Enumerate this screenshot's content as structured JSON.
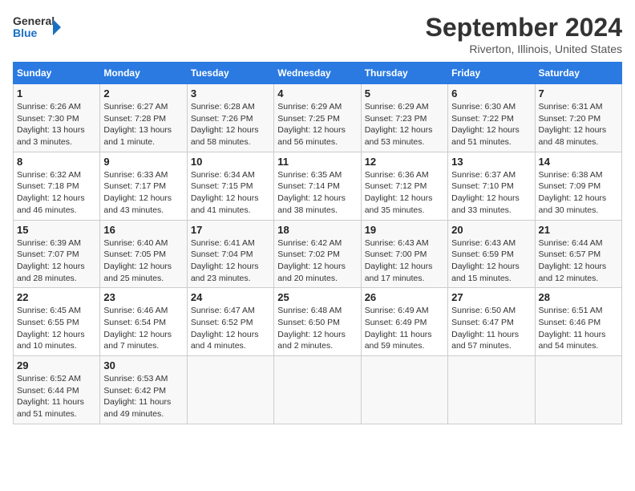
{
  "header": {
    "logo_line1": "General",
    "logo_line2": "Blue",
    "month": "September 2024",
    "location": "Riverton, Illinois, United States"
  },
  "columns": [
    "Sunday",
    "Monday",
    "Tuesday",
    "Wednesday",
    "Thursday",
    "Friday",
    "Saturday"
  ],
  "weeks": [
    [
      {
        "day": "1",
        "info": "Sunrise: 6:26 AM\nSunset: 7:30 PM\nDaylight: 13 hours\nand 3 minutes."
      },
      {
        "day": "2",
        "info": "Sunrise: 6:27 AM\nSunset: 7:28 PM\nDaylight: 13 hours\nand 1 minute."
      },
      {
        "day": "3",
        "info": "Sunrise: 6:28 AM\nSunset: 7:26 PM\nDaylight: 12 hours\nand 58 minutes."
      },
      {
        "day": "4",
        "info": "Sunrise: 6:29 AM\nSunset: 7:25 PM\nDaylight: 12 hours\nand 56 minutes."
      },
      {
        "day": "5",
        "info": "Sunrise: 6:29 AM\nSunset: 7:23 PM\nDaylight: 12 hours\nand 53 minutes."
      },
      {
        "day": "6",
        "info": "Sunrise: 6:30 AM\nSunset: 7:22 PM\nDaylight: 12 hours\nand 51 minutes."
      },
      {
        "day": "7",
        "info": "Sunrise: 6:31 AM\nSunset: 7:20 PM\nDaylight: 12 hours\nand 48 minutes."
      }
    ],
    [
      {
        "day": "8",
        "info": "Sunrise: 6:32 AM\nSunset: 7:18 PM\nDaylight: 12 hours\nand 46 minutes."
      },
      {
        "day": "9",
        "info": "Sunrise: 6:33 AM\nSunset: 7:17 PM\nDaylight: 12 hours\nand 43 minutes."
      },
      {
        "day": "10",
        "info": "Sunrise: 6:34 AM\nSunset: 7:15 PM\nDaylight: 12 hours\nand 41 minutes."
      },
      {
        "day": "11",
        "info": "Sunrise: 6:35 AM\nSunset: 7:14 PM\nDaylight: 12 hours\nand 38 minutes."
      },
      {
        "day": "12",
        "info": "Sunrise: 6:36 AM\nSunset: 7:12 PM\nDaylight: 12 hours\nand 35 minutes."
      },
      {
        "day": "13",
        "info": "Sunrise: 6:37 AM\nSunset: 7:10 PM\nDaylight: 12 hours\nand 33 minutes."
      },
      {
        "day": "14",
        "info": "Sunrise: 6:38 AM\nSunset: 7:09 PM\nDaylight: 12 hours\nand 30 minutes."
      }
    ],
    [
      {
        "day": "15",
        "info": "Sunrise: 6:39 AM\nSunset: 7:07 PM\nDaylight: 12 hours\nand 28 minutes."
      },
      {
        "day": "16",
        "info": "Sunrise: 6:40 AM\nSunset: 7:05 PM\nDaylight: 12 hours\nand 25 minutes."
      },
      {
        "day": "17",
        "info": "Sunrise: 6:41 AM\nSunset: 7:04 PM\nDaylight: 12 hours\nand 23 minutes."
      },
      {
        "day": "18",
        "info": "Sunrise: 6:42 AM\nSunset: 7:02 PM\nDaylight: 12 hours\nand 20 minutes."
      },
      {
        "day": "19",
        "info": "Sunrise: 6:43 AM\nSunset: 7:00 PM\nDaylight: 12 hours\nand 17 minutes."
      },
      {
        "day": "20",
        "info": "Sunrise: 6:43 AM\nSunset: 6:59 PM\nDaylight: 12 hours\nand 15 minutes."
      },
      {
        "day": "21",
        "info": "Sunrise: 6:44 AM\nSunset: 6:57 PM\nDaylight: 12 hours\nand 12 minutes."
      }
    ],
    [
      {
        "day": "22",
        "info": "Sunrise: 6:45 AM\nSunset: 6:55 PM\nDaylight: 12 hours\nand 10 minutes."
      },
      {
        "day": "23",
        "info": "Sunrise: 6:46 AM\nSunset: 6:54 PM\nDaylight: 12 hours\nand 7 minutes."
      },
      {
        "day": "24",
        "info": "Sunrise: 6:47 AM\nSunset: 6:52 PM\nDaylight: 12 hours\nand 4 minutes."
      },
      {
        "day": "25",
        "info": "Sunrise: 6:48 AM\nSunset: 6:50 PM\nDaylight: 12 hours\nand 2 minutes."
      },
      {
        "day": "26",
        "info": "Sunrise: 6:49 AM\nSunset: 6:49 PM\nDaylight: 11 hours\nand 59 minutes."
      },
      {
        "day": "27",
        "info": "Sunrise: 6:50 AM\nSunset: 6:47 PM\nDaylight: 11 hours\nand 57 minutes."
      },
      {
        "day": "28",
        "info": "Sunrise: 6:51 AM\nSunset: 6:46 PM\nDaylight: 11 hours\nand 54 minutes."
      }
    ],
    [
      {
        "day": "29",
        "info": "Sunrise: 6:52 AM\nSunset: 6:44 PM\nDaylight: 11 hours\nand 51 minutes."
      },
      {
        "day": "30",
        "info": "Sunrise: 6:53 AM\nSunset: 6:42 PM\nDaylight: 11 hours\nand 49 minutes."
      },
      null,
      null,
      null,
      null,
      null
    ]
  ]
}
